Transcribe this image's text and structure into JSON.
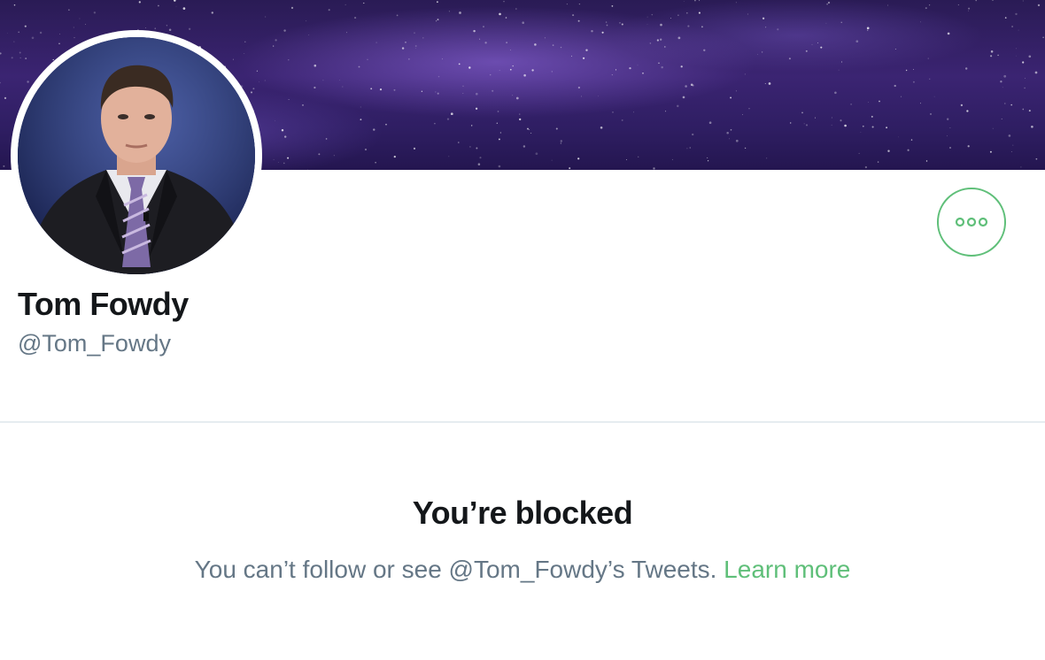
{
  "profile": {
    "display_name": "Tom Fowdy",
    "handle": "@Tom_Fowdy",
    "avatar_alt": "profile-photo"
  },
  "actions": {
    "more_icon": "more-horizontal-icon"
  },
  "blocked": {
    "title": "You’re blocked",
    "message": "You can’t follow or see @Tom_Fowdy’s Tweets. ",
    "learn_more": "Learn more"
  },
  "colors": {
    "accent": "#5fbf79",
    "text_primary": "#14171a",
    "text_secondary": "#657786",
    "divider": "#e6ecf0",
    "banner": "#2f1e63"
  }
}
